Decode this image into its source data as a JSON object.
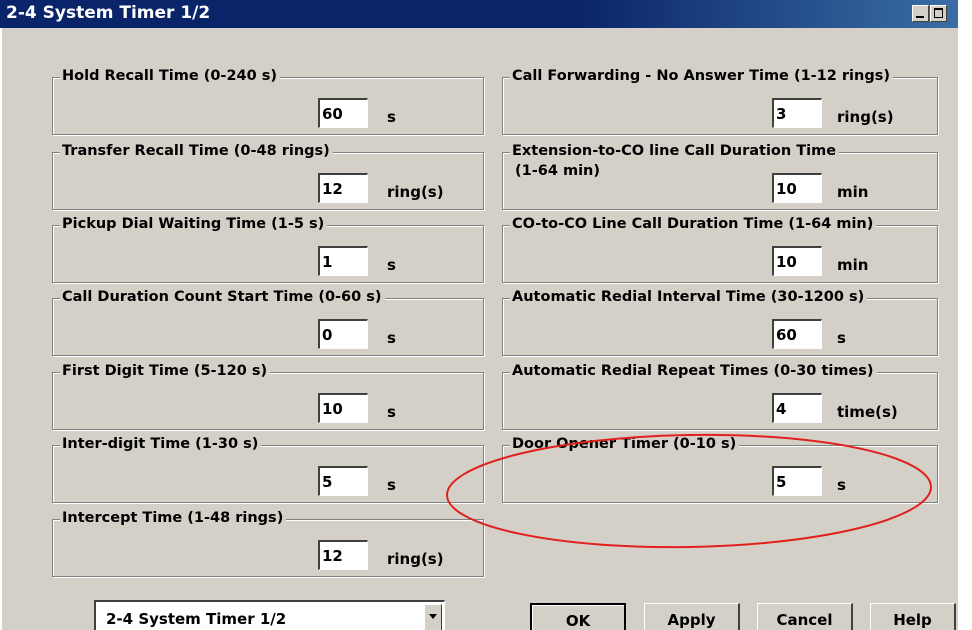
{
  "window": {
    "title": "2-4 System Timer 1/2"
  },
  "left_groups": [
    {
      "label": "Hold Recall Time (0-240 s)",
      "value": "60",
      "unit": "s"
    },
    {
      "label": "Transfer Recall Time (0-48 rings)",
      "value": "12",
      "unit": "ring(s)"
    },
    {
      "label": "Pickup Dial Waiting Time (1-5 s)",
      "value": "1",
      "unit": "s"
    },
    {
      "label": "Call Duration Count Start Time (0-60 s)",
      "value": "0",
      "unit": "s"
    },
    {
      "label": "First Digit Time (5-120 s)",
      "value": "10",
      "unit": "s"
    },
    {
      "label": "Inter-digit Time (1-30 s)",
      "value": "5",
      "unit": "s"
    },
    {
      "label": "Intercept Time (1-48 rings)",
      "value": "12",
      "unit": "ring(s)"
    }
  ],
  "right_groups": [
    {
      "label": "Call Forwarding - No Answer Time (1-12 rings)",
      "label2": "",
      "value": "3",
      "unit": "ring(s)"
    },
    {
      "label": "Extension-to-CO line Call Duration Time",
      "label2": "(1-64 min)",
      "value": "10",
      "unit": "min"
    },
    {
      "label": "CO-to-CO Line Call Duration Time (1-64 min)",
      "label2": "",
      "value": "10",
      "unit": "min"
    },
    {
      "label": "Automatic Redial Interval Time (30-1200 s)",
      "label2": "",
      "value": "60",
      "unit": "s"
    },
    {
      "label": "Automatic Redial Repeat Times (0-30 times)",
      "label2": "",
      "value": "4",
      "unit": "time(s)"
    },
    {
      "label": "Door Opener Timer (0-10 s)",
      "label2": "",
      "value": "5",
      "unit": "s"
    }
  ],
  "footer": {
    "page_select": "2-4 System Timer 1/2",
    "ok_label": "OK",
    "apply_label": "Apply",
    "cancel_label": "Cancel",
    "help_label": "Help"
  },
  "annotation": {
    "color": "#e0201c",
    "icon": "ellipse-highlight"
  }
}
